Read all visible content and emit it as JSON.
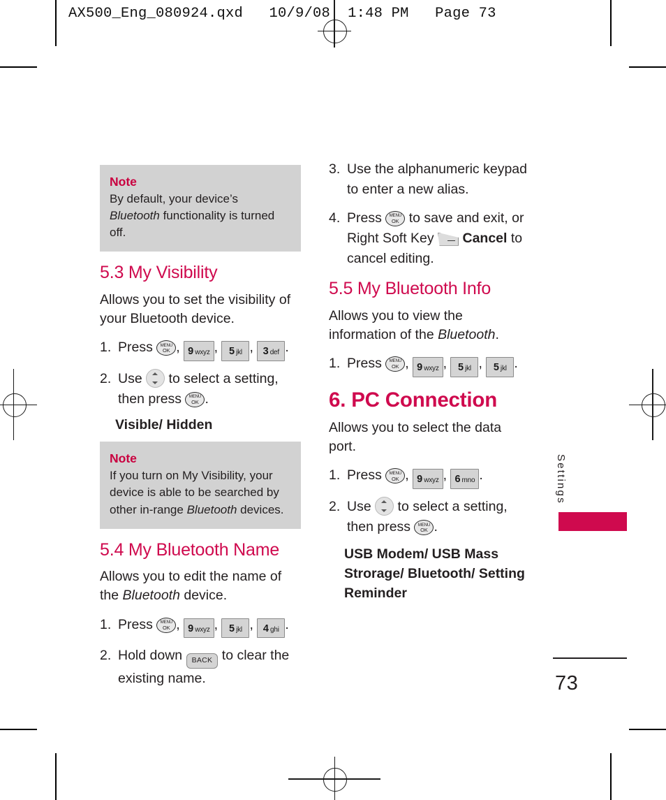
{
  "prepress": {
    "header": "AX500_Eng_080924.qxd   10/9/08  1:48 PM   Page 73"
  },
  "accent_color": "#cf0a4e",
  "note_bg_color": "#d2d2d2",
  "left_column": {
    "note1": {
      "title": "Note",
      "text_before": "By default, your device’s ",
      "italic": "Bluetooth",
      "text_after": " functionality is turned off."
    },
    "section_53": {
      "heading": "5.3 My Visibility",
      "intro": "Allows you to set the visibility of your Bluetooth device.",
      "step1": {
        "num": "1.",
        "label": "Press",
        "keys": [
          "MENU/OK",
          "9 wxyz",
          "5 jkl",
          "3 def"
        ]
      },
      "step2": {
        "num": "2.",
        "label_a": "Use",
        "label_b": "to select a setting, then press",
        "nav_key": "nav-wheel",
        "end_key": "MENU/OK"
      },
      "options": "Visible/ Hidden"
    },
    "note2": {
      "title": "Note",
      "text_before": "If you turn on My Visibility, your device is able to be searched by other in-range ",
      "italic": "Bluetooth",
      "text_after": " devices."
    },
    "section_54": {
      "heading": "5.4 My Bluetooth Name",
      "intro_a": "Allows you to edit the name of the ",
      "intro_italic": "Bluetooth",
      "intro_b": " device.",
      "step1": {
        "num": "1.",
        "label": "Press",
        "keys": [
          "MENU/OK",
          "9 wxyz",
          "5 jkl",
          "4 ghi"
        ]
      },
      "step2": {
        "num": "2.",
        "label_a": "Hold down",
        "label_b": "to clear the existing name."
      }
    }
  },
  "right_column": {
    "step3": {
      "num": "3.",
      "text": "Use the alphanumeric keypad to enter a new alias."
    },
    "step4": {
      "num": "4.",
      "label_a": "Press",
      "label_b": "to save and exit, or Right Soft Key",
      "cancel": "Cancel",
      "label_c": "to cancel editing."
    },
    "section_55": {
      "heading": "5.5 My Bluetooth Info",
      "intro_a": "Allows you to view the information of the ",
      "intro_italic": "Bluetooth",
      "intro_b": ".",
      "step1": {
        "num": "1.",
        "label": "Press",
        "keys": [
          "MENU/OK",
          "9 wxyz",
          "5 jkl",
          "5 jkl"
        ]
      }
    },
    "section_6": {
      "heading": "6. PC Connection",
      "intro": "Allows you to select the data port.",
      "step1": {
        "num": "1.",
        "label": "Press",
        "keys": [
          "MENU/OK",
          "9 wxyz",
          "6 mno"
        ]
      },
      "step2": {
        "num": "2.",
        "label_a": "Use",
        "label_b": "to select a setting, then press",
        "nav_key": "nav-wheel",
        "end_key": "MENU/OK"
      },
      "options": "USB Modem/ USB Mass Strorage/ Bluetooth/ Setting Reminder"
    }
  },
  "keys": {
    "menu_line1": "MENU",
    "menu_line2": "OK",
    "back": "BACK",
    "k9": {
      "digit": "9",
      "letters": "wxyz"
    },
    "k5": {
      "digit": "5",
      "letters": "jkl"
    },
    "k3": {
      "digit": "3",
      "letters": "def"
    },
    "k4": {
      "digit": "4",
      "letters": "ghi"
    },
    "k6": {
      "digit": "6",
      "letters": "mno"
    }
  },
  "thumb_tab": {
    "label": "Settings"
  },
  "footer": {
    "page_number": "73"
  },
  "punct": {
    "comma": ",",
    "period": "."
  }
}
